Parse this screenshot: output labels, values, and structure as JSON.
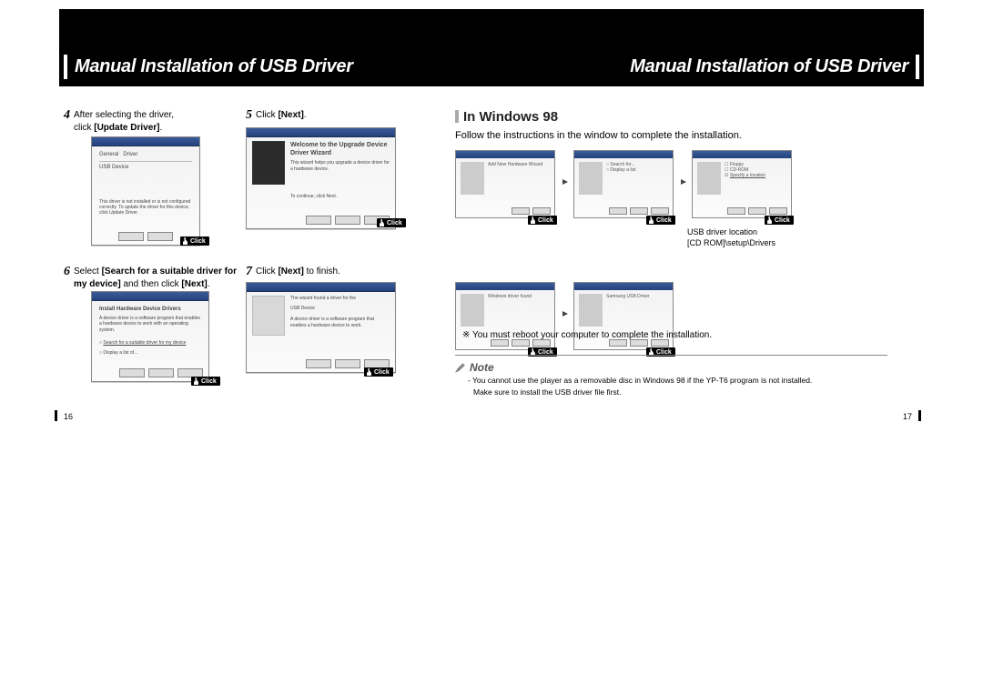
{
  "header": {
    "title_left": "Manual Installation of USB Driver",
    "title_right": "Manual Installation of USB Driver"
  },
  "left_page": {
    "steps": [
      {
        "num": "4",
        "text_pre": "After selecting the driver,\nclick ",
        "bold": "[Update Driver]",
        "text_post": "."
      },
      {
        "num": "5",
        "text_pre": "Click ",
        "bold": "[Next]",
        "text_post": "."
      },
      {
        "num": "6",
        "text_pre": "Select ",
        "bold": "[Search for a suitable driver for my device]",
        "text_post": " and then click ",
        "bold2": "[Next]",
        "text_post2": "."
      },
      {
        "num": "7",
        "text_pre": "Click ",
        "bold": "[Next]",
        "text_post": " to finish."
      }
    ],
    "click_label": "Click",
    "shot5_title": "Welcome to the Upgrade Device Driver Wizard",
    "shot5_body": "This wizard helps you upgrade a device driver for a hardware device.",
    "shot5_footer": "To continue, click Next."
  },
  "right_page": {
    "section_title": "In Windows 98",
    "intro": "Follow the instructions in the window to complete the installation.",
    "usb_location_label": "USB driver location",
    "usb_location_path": "[CD ROM]\\setup\\Drivers",
    "reboot_note_bullet": "※",
    "reboot_note": "You must reboot your computer to complete the installation.",
    "note_label": "Note",
    "note_line1": "- You cannot use the player as a removable disc in Windows 98 if the YP-T6 program is not installed.",
    "note_line2": "Make sure to install the USB driver file first.",
    "click_label": "Click"
  },
  "pages": {
    "left_num": "16",
    "right_num": "17"
  }
}
